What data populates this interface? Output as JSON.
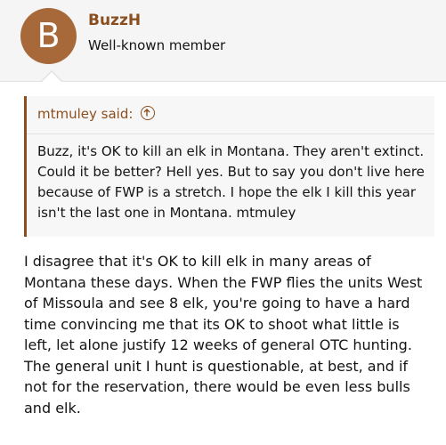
{
  "author": {
    "avatar_letter": "B",
    "avatar_color": "#a7693a",
    "username": "BuzzH",
    "title": "Well-known member"
  },
  "quote": {
    "attribution": "mtmuley said:",
    "icon": "arrow-up-circle-icon",
    "lines": [
      "Buzz, it's OK to kill an elk in Montana. They aren't extinct.",
      "Could it be better? Hell yes. But to say you don't live here",
      "because of FWP is a stretch. I hope the elk I kill this year",
      "isn't the last one in Montana. mtmuley"
    ]
  },
  "post": {
    "lines": [
      "I disagree that it's OK to kill elk in many areas of",
      "Montana these days. When the FWP flies the units West",
      "of Missoula and see 8 elk, you're going to have a hard",
      "time convincing me that its OK to shoot what little is",
      "left, let alone justify 12 weeks of general OTC hunting.",
      "The general unit I hunt is questionable, at best, and if",
      "not for the reservation, there would be even less bulls",
      "and elk."
    ]
  },
  "colors": {
    "accent": "#8b4f1f",
    "quote_bg": "#f7f7f7",
    "header_bg": "#f5f5f5"
  }
}
